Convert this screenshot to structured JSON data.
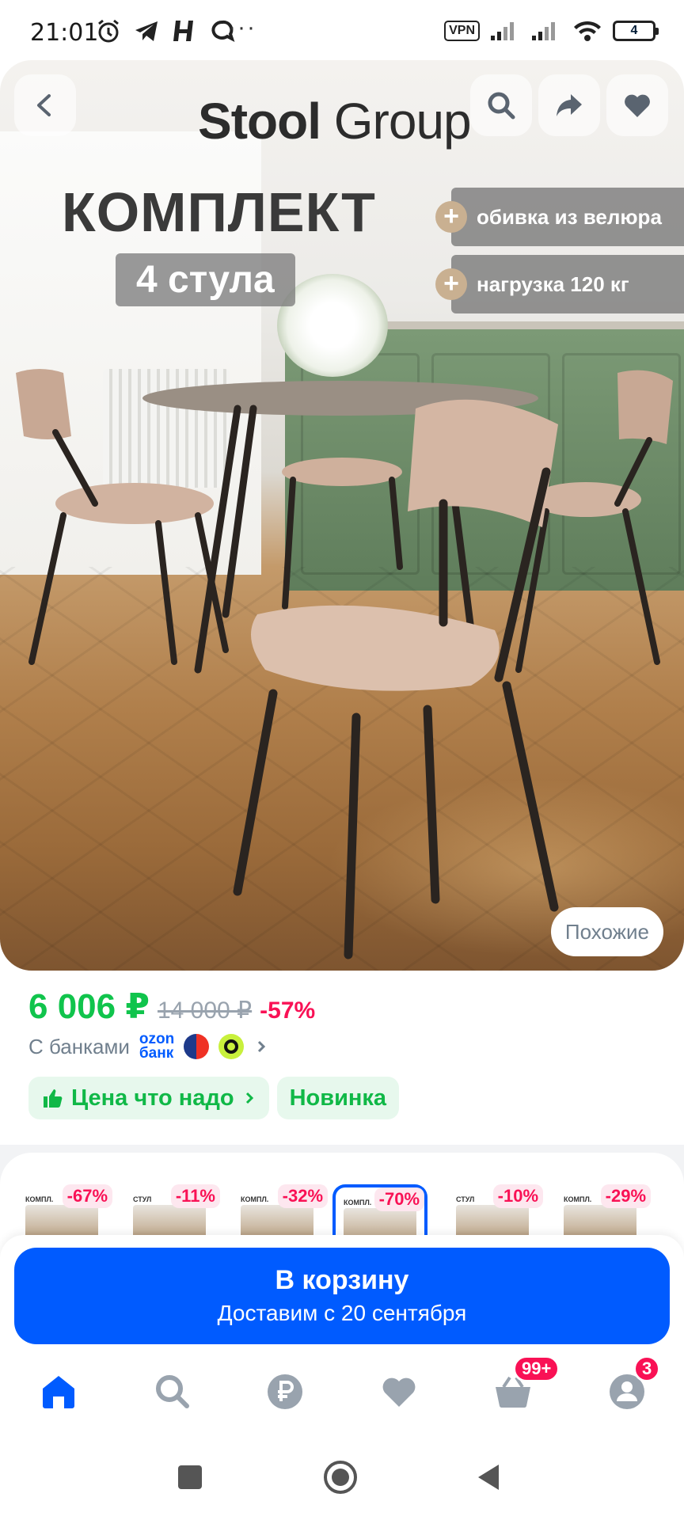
{
  "status_bar": {
    "time": "21:01",
    "extra": "···",
    "vpn": "VPN",
    "battery": "4"
  },
  "hero": {
    "brand_bold": "Stool",
    "brand_light": "Group",
    "title": "КОМПЛЕКТ",
    "subtitle": "4 стула",
    "features": [
      "обивка из велюра",
      "нагрузка 120 кг"
    ],
    "similar_button": "Похожие"
  },
  "price": {
    "current": "6 006 ₽",
    "old": "14 000 ₽",
    "discount": "-57%",
    "banks_label": "С банками",
    "ozon_bank": [
      "ozon",
      "банк"
    ]
  },
  "badges": [
    "Цена что надо",
    "Новинка"
  ],
  "similar_items": [
    {
      "title": "КОМПЛ.",
      "discount": "-67%"
    },
    {
      "title": "СТУЛ",
      "discount": "-11%"
    },
    {
      "title": "КОМПЛ.",
      "discount": "-32%"
    },
    {
      "title": "КОМПЛ.",
      "discount": "-70%"
    },
    {
      "title": "СТУЛ",
      "discount": "-10%"
    },
    {
      "title": "КОМПЛ.",
      "discount": "-29%"
    }
  ],
  "cart": {
    "label": "В корзину",
    "delivery": "Доставим с 20 сентября"
  },
  "nav": {
    "cart_badge": "99+",
    "profile_badge": "3"
  },
  "colors": {
    "accent": "#005bff",
    "price_green": "#10c44c",
    "discount_pink": "#f91155"
  }
}
